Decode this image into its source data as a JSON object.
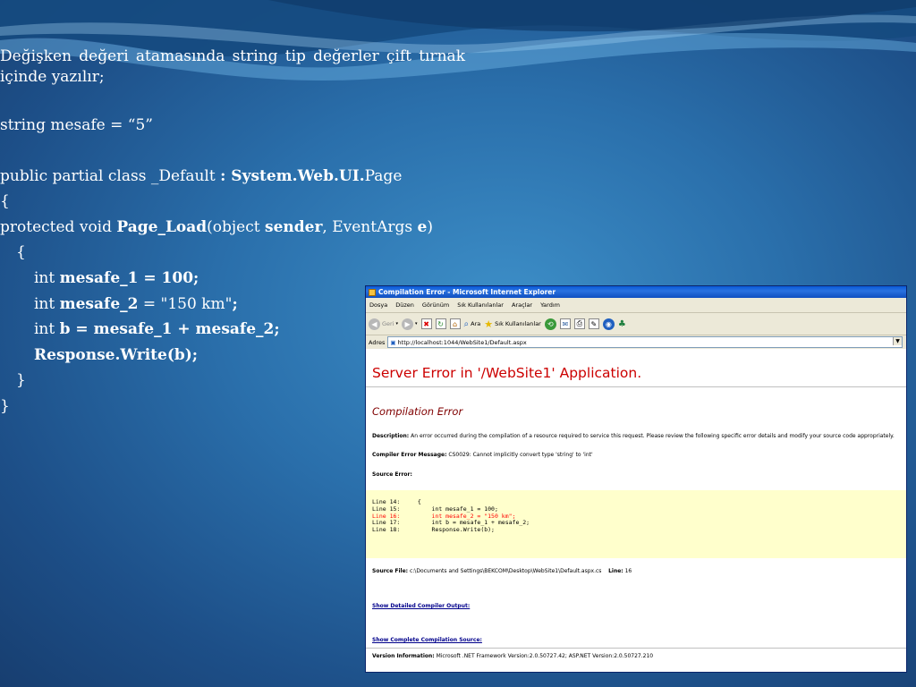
{
  "slide": {
    "intro": "Değişken değeri atamasında string tip değerler çift tırnak içinde yazılır;",
    "assign": "string mesafe = “5”",
    "code": {
      "cls_a": "public partial class _Default ",
      "cls_b": ": System.Web.UI.",
      "cls_c": "Page",
      "open1": "{",
      "m_a": "protected void ",
      "m_b": "Page_Load",
      "m_c": "(object ",
      "m_d": "sender",
      "m_e": ", EventArgs ",
      "m_f": "e",
      "m_g": ")",
      "open2": "{",
      "l1_a": "int ",
      "l1_b": "mesafe_1 = 100;",
      "l2_a": "int ",
      "l2_b": "mesafe_2",
      "l2_c": " = \"150 km\"",
      "l2_d": ";",
      "l3_a": "int ",
      "l3_b": "b = mesafe_1 + mesafe_2;",
      "l4": "Response.Write(b);",
      "close2": "}",
      "close1": "}"
    }
  },
  "browser": {
    "title": "Compilation Error - Microsoft Internet Explorer",
    "menu": [
      "Dosya",
      "Düzen",
      "Görünüm",
      "Sık Kullanılanlar",
      "Araçlar",
      "Yardım"
    ],
    "back_label": "Geri",
    "search_label": "Ara",
    "favorites_label": "Sık Kullanılanlar",
    "address_label": "Adres",
    "url": "http://localhost:1044/WebSite1/Default.aspx",
    "server_error": "Server Error in '/WebSite1' Application.",
    "compilation_error": "Compilation Error",
    "desc_label": "Description:",
    "desc_text": " An error occurred during the compilation of a resource required to service this request. Please review the following specific error details and modify your source code appropriately.",
    "cem_label": "Compiler Error Message:",
    "cem_text": " CS0029: Cannot implicitly convert type 'string' to 'int'",
    "source_error_label": "Source Error:",
    "source_lines": [
      "Line 14:     {",
      "Line 15:         int mesafe_1 = 100;",
      "Line 16:         int mesafe_2 = \"150 km\";",
      "Line 17:         int b = mesafe_1 + mesafe_2;",
      "Line 18:         Response.Write(b);"
    ],
    "source_file_label": "Source File:",
    "source_file": " c:\\Documents and Settings\\BEKCOM\\Desktop\\WebSite1\\Default.aspx.cs",
    "line_label": "Line:",
    "line_num": " 16",
    "link_detailed": "Show Detailed Compiler Output:",
    "link_complete": "Show Complete Compilation Source:",
    "version_label": "Version Information:",
    "version_text": " Microsoft .NET Framework Version:2.0.50727.42; ASP.NET Version:2.0.50727.210"
  },
  "colors": {
    "error_red": "#cc0000",
    "compilation_maroon": "#800000",
    "source_bg": "#ffffcc"
  }
}
